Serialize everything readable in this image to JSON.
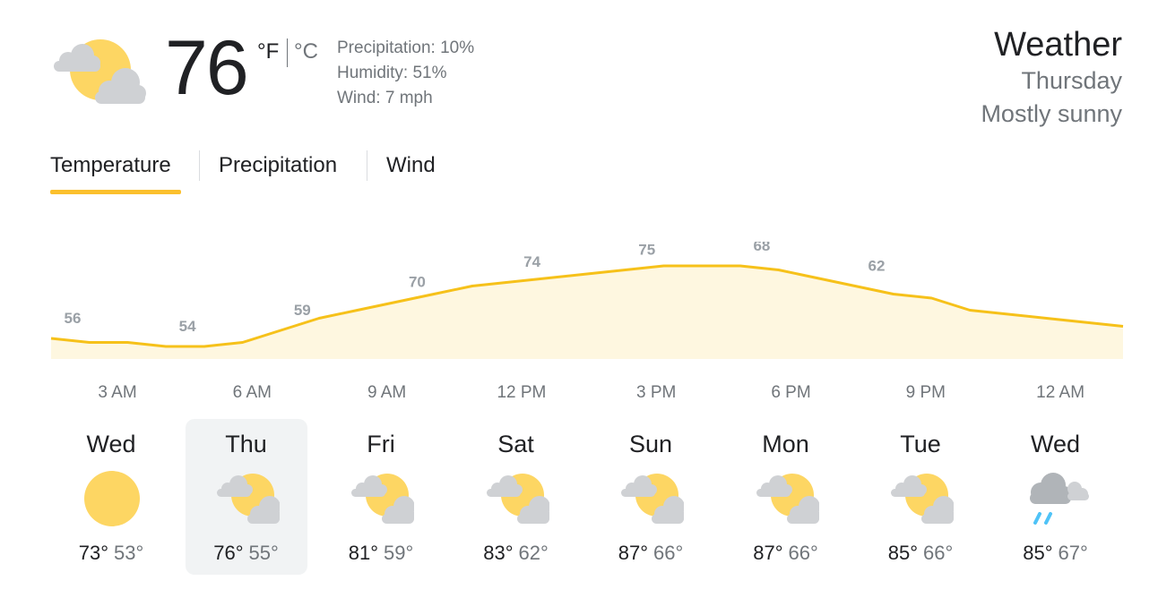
{
  "current": {
    "icon": "partly-cloudy-icon",
    "temp": "76",
    "unit_f": "°F",
    "unit_c": "°C",
    "precipitation": "Precipitation: 10%",
    "humidity": "Humidity: 51%",
    "wind": "Wind: 7 mph"
  },
  "header": {
    "title": "Weather",
    "day": "Thursday",
    "condition": "Mostly sunny"
  },
  "tabs": [
    {
      "label": "Temperature",
      "selected": true
    },
    {
      "label": "Precipitation",
      "selected": false
    },
    {
      "label": "Wind",
      "selected": false
    }
  ],
  "colors": {
    "accent": "#fbc02d",
    "chart_line": "#f6c11a",
    "chart_fill": "#fef7e0",
    "sun": "#fdd663",
    "cloud": "#cfd1d4",
    "rain": "#4fc3f7"
  },
  "chart_data": {
    "type": "area",
    "series": [
      {
        "values": [
          56,
          55,
          55,
          54,
          54,
          55,
          58,
          61,
          63,
          65,
          67,
          69,
          70,
          71,
          72,
          73,
          74,
          74,
          74,
          73,
          71,
          69,
          67,
          66,
          63,
          62,
          61,
          60,
          59
        ]
      }
    ],
    "point_labels": [
      {
        "index": 0,
        "value": "56"
      },
      {
        "index": 3,
        "value": "54"
      },
      {
        "index": 6,
        "value": "59"
      },
      {
        "index": 9,
        "value": "70"
      },
      {
        "index": 12,
        "value": "74"
      },
      {
        "index": 15,
        "value": "75"
      },
      {
        "index": 18,
        "value": "68"
      },
      {
        "index": 21,
        "value": "62"
      }
    ],
    "x_tick_labels": [
      "3 AM",
      "6 AM",
      "9 AM",
      "12 PM",
      "3 PM",
      "6 PM",
      "9 PM",
      "12 AM"
    ],
    "ylim": [
      40,
      80
    ]
  },
  "forecast": [
    {
      "day": "Wed",
      "icon": "sunny-icon",
      "high": "73°",
      "low": "53°",
      "selected": false
    },
    {
      "day": "Thu",
      "icon": "partly-cloudy-icon",
      "high": "76°",
      "low": "55°",
      "selected": true
    },
    {
      "day": "Fri",
      "icon": "partly-cloudy-icon",
      "high": "81°",
      "low": "59°",
      "selected": false
    },
    {
      "day": "Sat",
      "icon": "partly-cloudy-icon",
      "high": "83°",
      "low": "62°",
      "selected": false
    },
    {
      "day": "Sun",
      "icon": "partly-cloudy-icon",
      "high": "87°",
      "low": "66°",
      "selected": false
    },
    {
      "day": "Mon",
      "icon": "partly-cloudy-icon",
      "high": "87°",
      "low": "66°",
      "selected": false
    },
    {
      "day": "Tue",
      "icon": "partly-cloudy-icon",
      "high": "85°",
      "low": "66°",
      "selected": false
    },
    {
      "day": "Wed",
      "icon": "rain-showers-icon",
      "high": "85°",
      "low": "67°",
      "selected": false
    }
  ]
}
